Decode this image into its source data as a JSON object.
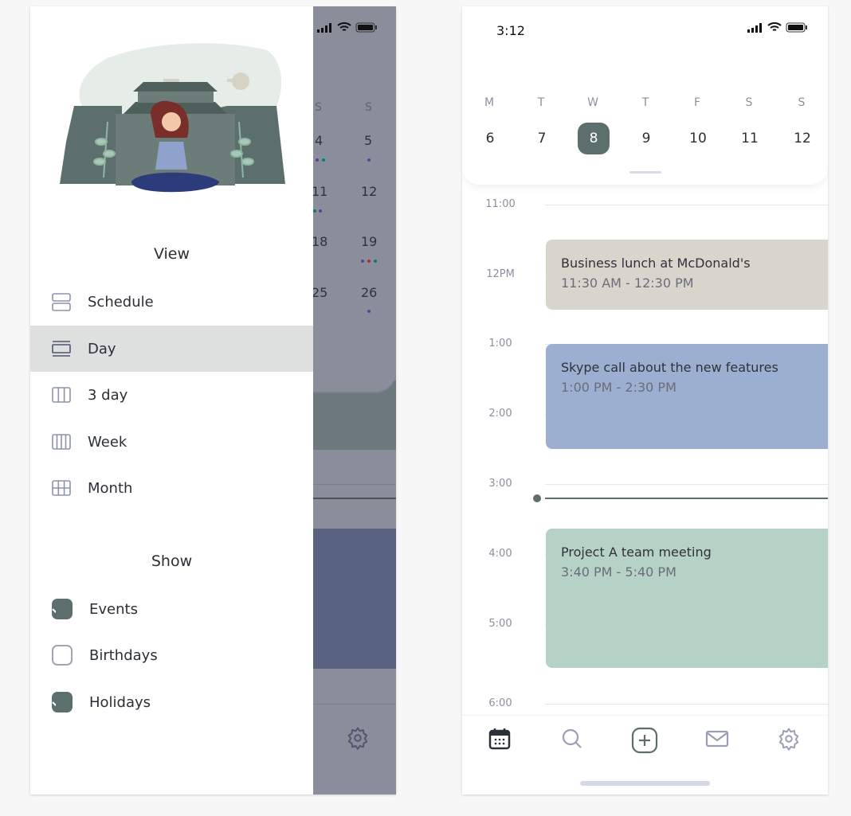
{
  "left_screen": {
    "drawer": {
      "view_title": "View",
      "view_items": [
        {
          "label": "Schedule",
          "icon": "schedule-icon",
          "active": false
        },
        {
          "label": "Day",
          "icon": "day-icon",
          "active": true
        },
        {
          "label": "3 day",
          "icon": "three-day-icon",
          "active": false
        },
        {
          "label": "Week",
          "icon": "week-icon",
          "active": false
        },
        {
          "label": "Month",
          "icon": "month-icon",
          "active": false
        }
      ],
      "show_title": "Show",
      "show_items": [
        {
          "label": "Events",
          "checked": true
        },
        {
          "label": "Birthdays",
          "checked": false
        },
        {
          "label": "Holidays",
          "checked": true
        }
      ]
    },
    "background": {
      "dow": [
        "S",
        "S"
      ],
      "dates": [
        "4",
        "5",
        "11",
        "12",
        "18",
        "19",
        "25",
        "26"
      ]
    }
  },
  "right_screen": {
    "status_time": "3:12",
    "week": {
      "days": [
        "M",
        "T",
        "W",
        "T",
        "F",
        "S",
        "S"
      ],
      "dates": [
        "6",
        "7",
        "8",
        "9",
        "10",
        "11",
        "12"
      ],
      "selected_index": 2
    },
    "hours": [
      "11:00",
      "12PM",
      "1:00",
      "2:00",
      "3:00",
      "4:00",
      "5:00",
      "6:00"
    ],
    "events": [
      {
        "title": "Business lunch at McDonald's",
        "time": "11:30 AM - 12:30 PM",
        "color": "#d8d5cd"
      },
      {
        "title": "Skype call about the new features",
        "time": "1:00 PM - 2:30 PM",
        "color": "#9dafd1"
      },
      {
        "title": "Project A team meeting",
        "time": "3:40 PM - 5:40 PM",
        "color": "#b6d1c6"
      }
    ],
    "tabs": [
      "calendar-icon",
      "search-icon",
      "add-icon",
      "mail-icon",
      "settings-icon"
    ],
    "accent": "#5d6f6c"
  }
}
